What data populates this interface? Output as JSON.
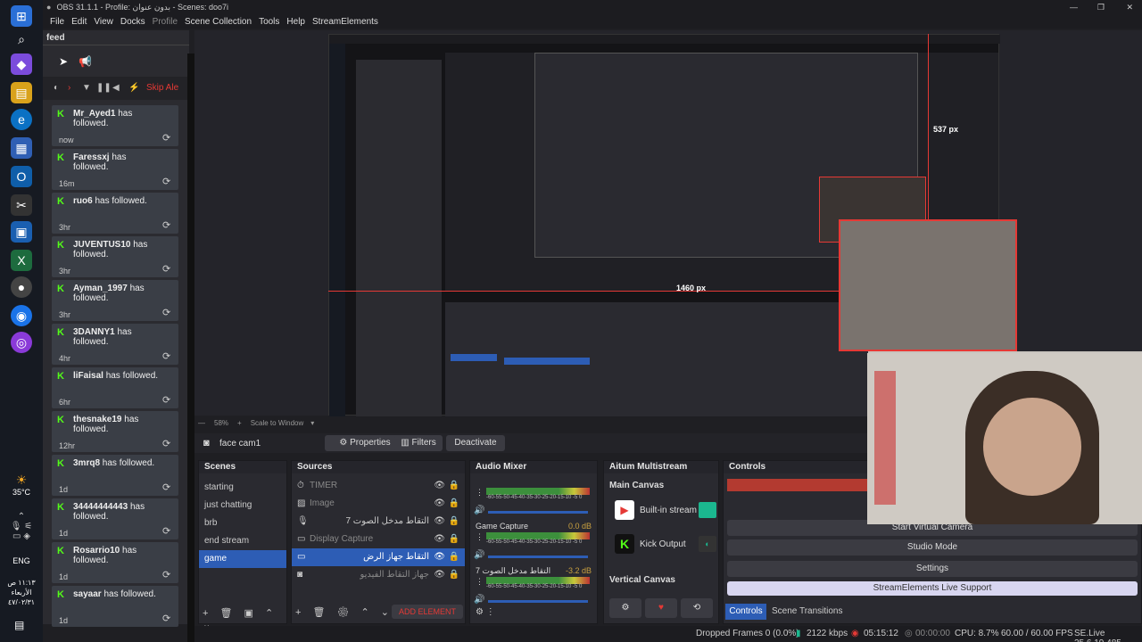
{
  "window": {
    "title": "OBS 31.1.1 - Profile: بدون عنوان - Scenes: doo7i"
  },
  "menu": [
    "File",
    "Edit",
    "View",
    "Docks",
    "Profile",
    "Scene Collection",
    "Tools",
    "Help",
    "StreamElements"
  ],
  "feed": {
    "title": "feed",
    "skip_label": "Skip Ale",
    "items": [
      {
        "name": "Mr_Ayed1",
        "text": "has followed.",
        "time": "now"
      },
      {
        "name": "Faressxj",
        "text": "has followed.",
        "time": "16m"
      },
      {
        "name": "ruo6",
        "text": "has followed.",
        "time": "3hr"
      },
      {
        "name": "JUVENTUS10",
        "text": "has followed.",
        "time": "3hr"
      },
      {
        "name": "Ayman_1997",
        "text": "has followed.",
        "time": "3hr"
      },
      {
        "name": "3DANNY1",
        "text": "has followed.",
        "time": "4hr"
      },
      {
        "name": "liFaisal",
        "text": "has followed.",
        "time": "6hr"
      },
      {
        "name": "thesnake19",
        "text": "has followed.",
        "time": "12hr"
      },
      {
        "name": "3mrq8",
        "text": "has followed.",
        "time": "1d"
      },
      {
        "name": "34444444443",
        "text": "has followed.",
        "time": "1d"
      },
      {
        "name": "Rosarrio10",
        "text": "has followed.",
        "time": "1d"
      },
      {
        "name": "sayaar",
        "text": "has followed.",
        "time": "1d"
      }
    ]
  },
  "taskbar": {
    "weather": "35°C",
    "lang": "ENG",
    "time": "١١:١٣ ص",
    "day": "الأربعاء",
    "date": "٤٧/٠٢/٣١"
  },
  "preview": {
    "zoom": "58%",
    "scale": "Scale to Window",
    "label_w": "1460 px",
    "label_h": "537 px"
  },
  "source_bar": {
    "source": "face cam1",
    "properties": "Properties",
    "filters": "Filters",
    "deactivate": "Deactivate"
  },
  "scenes": {
    "title": "Scenes",
    "items": [
      "starting",
      "just chatting",
      "brb",
      "end stream",
      "game"
    ],
    "selected": "game"
  },
  "sources": {
    "title": "Sources",
    "items": [
      "TIMER",
      "Image",
      "التقاط مدخل الصوت 7",
      "Display Capture",
      "التقاط جهاز الرض",
      "جهاز التقاط الفيديو"
    ],
    "add_element": "ADD ELEMENT"
  },
  "mixer": {
    "title": "Audio Mixer",
    "tracks": [
      {
        "name": "",
        "db": ""
      },
      {
        "name": "Game Capture",
        "db": "0.0 dB"
      },
      {
        "name": "التقاط مدخل الصوت 7",
        "db": "-3.2 dB"
      }
    ],
    "scale": "-60-55-50-45-40-35-30-25-20-15-10 -5  0"
  },
  "multistream": {
    "title": "Aitum Multistream",
    "main": "Main Canvas",
    "builtin": "Built-in stream",
    "kick": "Kick Output",
    "vertical": "Vertical Canvas"
  },
  "controls": {
    "title": "Controls",
    "virtual_camera": "Start Virtual Camera",
    "studio": "Studio Mode",
    "settings": "Settings",
    "se_support": "StreamElements Live Support",
    "tab_controls": "Controls",
    "tab_transitions": "Scene Transitions"
  },
  "status": {
    "dropped": "Dropped Frames 0 (0.0%)",
    "kbps": "2122 kbps",
    "rec_time": "05:15:12",
    "stream_time": "00:00:00",
    "cpu": "CPU: 8.7%",
    "fps": "60.00 / 60.00 FPS",
    "se": "SE.Live 25.6.19.485"
  },
  "colors": {
    "accent": "#2d5db5",
    "kick": "#53fc18",
    "red": "#e53935"
  }
}
